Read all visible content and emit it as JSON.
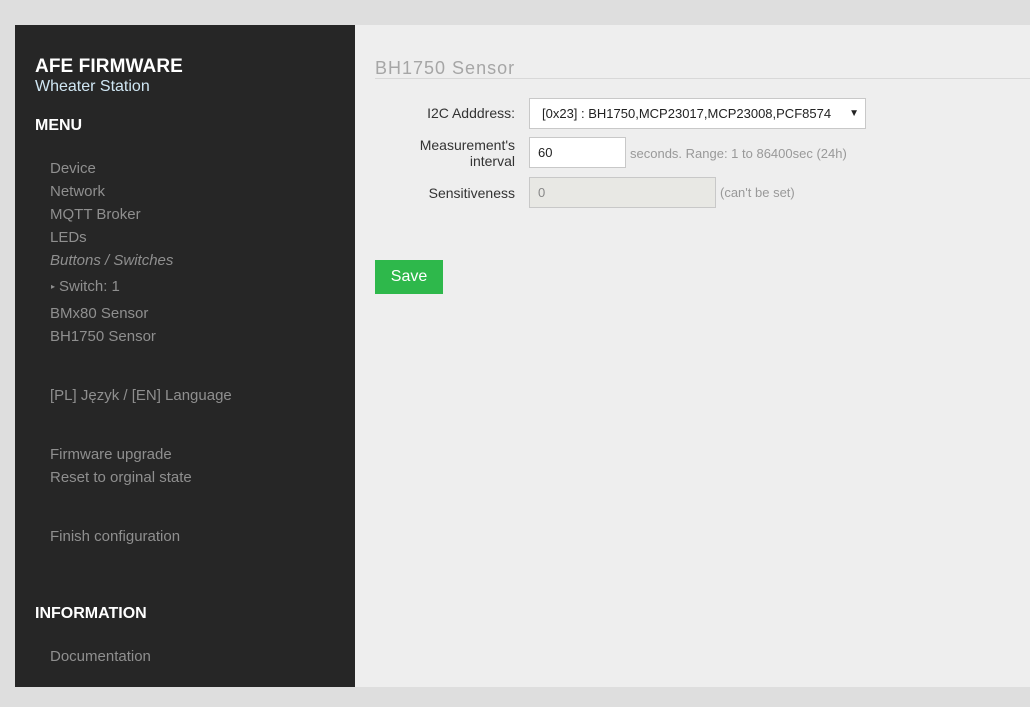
{
  "brand": {
    "title": "AFE FIRMWARE",
    "subtitle": "Wheater Station"
  },
  "menu": {
    "heading": "MENU",
    "items": [
      "Device",
      "Network",
      "MQTT Broker",
      "LEDs",
      "Buttons / Switches",
      "Switch: 1",
      "BMx80 Sensor",
      "BH1750 Sensor",
      "[PL] Język / [EN] Language",
      "Firmware upgrade",
      "Reset to orginal state",
      "Finish configuration"
    ]
  },
  "information": {
    "heading": "INFORMATION",
    "items": [
      "Documentation"
    ]
  },
  "page": {
    "title": "BH1750 Sensor",
    "fields": {
      "i2c_label": "I2C Adddress:",
      "i2c_value": "[0x23] : BH1750,MCP23017,MCP23008,PCF8574",
      "interval_label_1": "Measurement's",
      "interval_label_2": "interval",
      "interval_value": "60",
      "interval_hint": "seconds. Range: 1 to 86400sec (24h)",
      "sensitiveness_label": "Sensitiveness",
      "sensitiveness_value": "0",
      "sensitiveness_hint": "(can't be set)"
    },
    "save_label": "Save"
  },
  "colors": {
    "sidebar_bg": "#262626",
    "main_bg": "#eeeeee",
    "accent_green": "#2eb84b"
  }
}
